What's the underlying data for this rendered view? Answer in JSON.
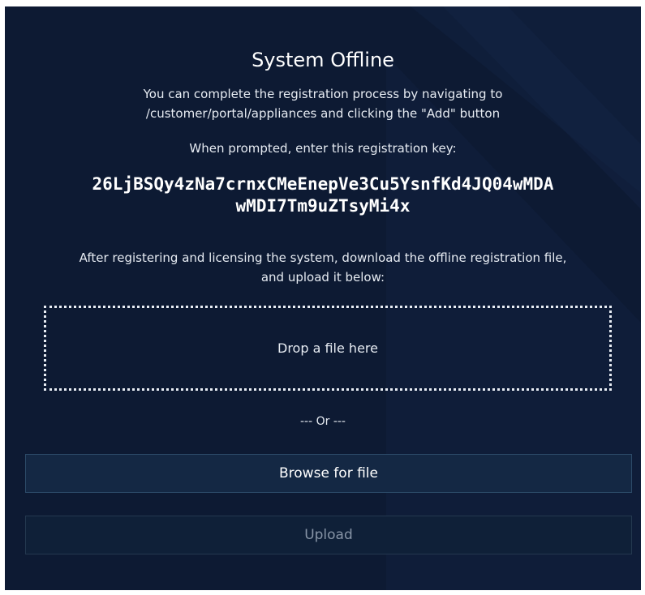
{
  "dialog": {
    "title": "System Offline",
    "instructions_line1": "You can complete the registration process by navigating to",
    "instructions_line2": "/customer/portal/appliances and clicking the \"Add\" button",
    "prompt": "When prompted, enter this registration key:",
    "registration_key_line1": "26LjBSQy4zNa7crnxCMeEnepVe3Cu5YsnfKd4JQ04wMDA",
    "registration_key_line2": "wMDI7Tm9uZTsyMi4x",
    "after_line1": "After registering and licensing the system, download the offline registration file,",
    "after_line2": "and upload it below:",
    "dropzone_label": "Drop a file here",
    "or_separator": "--- Or ---",
    "browse_button": "Browse for file",
    "upload_button": "Upload"
  },
  "colors": {
    "background": "#0d1a33",
    "button": "#142844",
    "upload_disabled_text": "#8794a6"
  }
}
